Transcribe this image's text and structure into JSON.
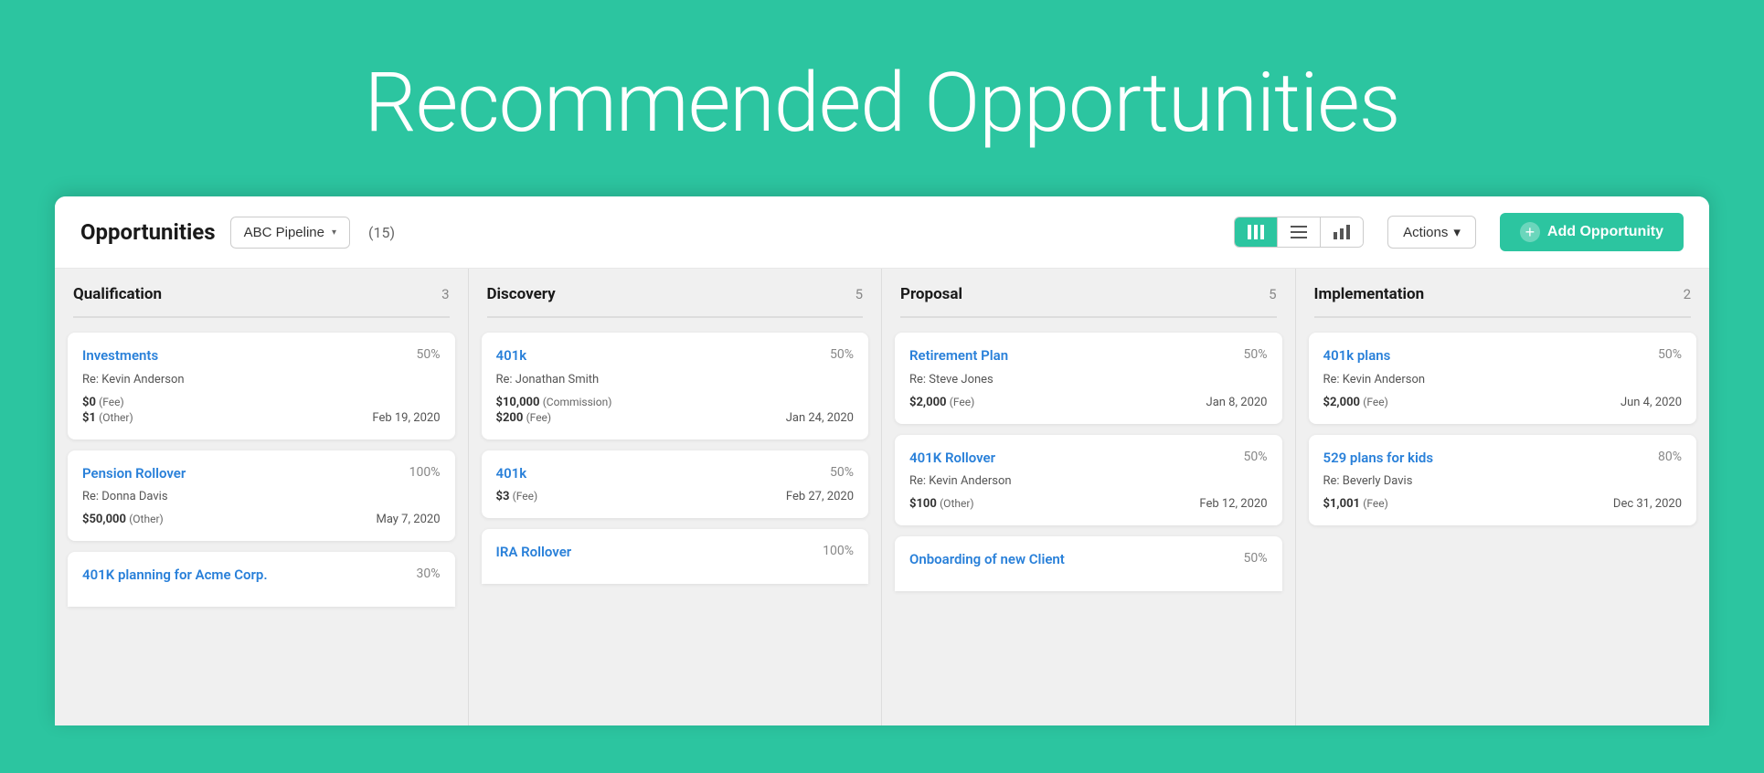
{
  "hero": {
    "title": "Recommended Opportunities"
  },
  "header": {
    "title": "Opportunities",
    "pipeline": "ABC Pipeline",
    "count": "(15)",
    "actions_label": "Actions",
    "add_label": "Add Opportunity",
    "views": [
      {
        "id": "kanban",
        "label": "|||",
        "active": true
      },
      {
        "id": "list",
        "label": "≡",
        "active": false
      },
      {
        "id": "chart",
        "label": "chart",
        "active": false
      }
    ]
  },
  "columns": [
    {
      "id": "qualification",
      "title": "Qualification",
      "count": 3,
      "cards": [
        {
          "title": "Investments",
          "percent": "50%",
          "re": "Re: Kevin Anderson",
          "amounts": [
            {
              "value": "$0",
              "label": "(Fee)"
            },
            {
              "value": "$1",
              "label": "(Other)"
            }
          ],
          "date": "Feb 19, 2020"
        },
        {
          "title": "Pension Rollover",
          "percent": "100%",
          "re": "Re: Donna Davis",
          "amounts": [
            {
              "value": "$50,000",
              "label": "(Other)"
            }
          ],
          "date": "May 7, 2020"
        },
        {
          "title": "401K planning for Acme Corp.",
          "percent": "30%",
          "re": "",
          "amounts": [],
          "date": "",
          "partial": true
        }
      ]
    },
    {
      "id": "discovery",
      "title": "Discovery",
      "count": 5,
      "cards": [
        {
          "title": "401k",
          "percent": "50%",
          "re": "Re: Jonathan Smith",
          "amounts": [
            {
              "value": "$10,000",
              "label": "(Commission)"
            },
            {
              "value": "$200",
              "label": "(Fee)"
            }
          ],
          "date": "Jan 24, 2020"
        },
        {
          "title": "401k",
          "percent": "50%",
          "re": "",
          "amounts": [
            {
              "value": "$3",
              "label": "(Fee)"
            }
          ],
          "date": "Feb 27, 2020"
        },
        {
          "title": "IRA Rollover",
          "percent": "100%",
          "re": "",
          "amounts": [],
          "date": "",
          "partial": true
        }
      ]
    },
    {
      "id": "proposal",
      "title": "Proposal",
      "count": 5,
      "cards": [
        {
          "title": "Retirement Plan",
          "percent": "50%",
          "re": "Re: Steve Jones",
          "amounts": [
            {
              "value": "$2,000",
              "label": "(Fee)"
            }
          ],
          "date": "Jan 8, 2020"
        },
        {
          "title": "401K Rollover",
          "percent": "50%",
          "re": "Re: Kevin Anderson",
          "amounts": [
            {
              "value": "$100",
              "label": "(Other)"
            }
          ],
          "date": "Feb 12, 2020"
        },
        {
          "title": "Onboarding of new Client",
          "percent": "50%",
          "re": "",
          "amounts": [],
          "date": "",
          "partial": true
        }
      ]
    },
    {
      "id": "implementation",
      "title": "Implementation",
      "count": 2,
      "cards": [
        {
          "title": "401k plans",
          "percent": "50%",
          "re": "Re: Kevin Anderson",
          "amounts": [
            {
              "value": "$2,000",
              "label": "(Fee)"
            }
          ],
          "date": "Jun 4, 2020"
        },
        {
          "title": "529 plans for kids",
          "percent": "80%",
          "re": "Re: Beverly Davis",
          "amounts": [
            {
              "value": "$1,001",
              "label": "(Fee)"
            }
          ],
          "date": "Dec 31, 2020"
        }
      ]
    }
  ]
}
